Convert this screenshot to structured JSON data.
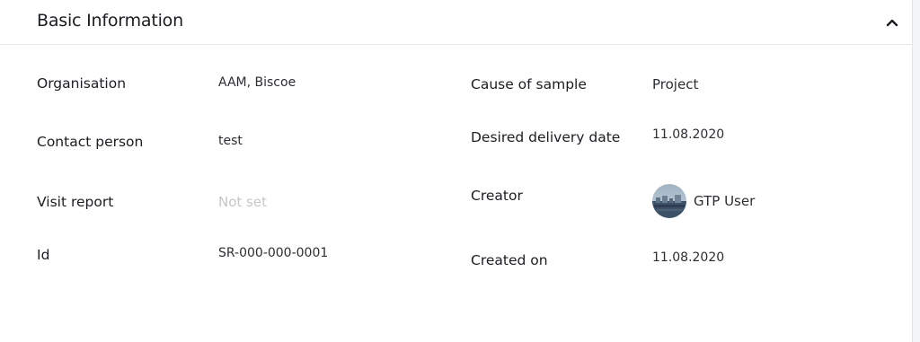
{
  "section": {
    "title": "Basic Information",
    "collapse_icon": "chevron-up-icon"
  },
  "left_fields": {
    "organisation": {
      "label": "Organisation",
      "value": "AAM, Biscoe"
    },
    "contact_person": {
      "label": "Contact person",
      "value": "test"
    },
    "visit_report": {
      "label": "Visit report",
      "value": "Not set"
    },
    "id": {
      "label": "Id",
      "value": "SR-000-000-0001"
    }
  },
  "right_fields": {
    "cause_of_sample": {
      "label": "Cause of sample",
      "value": "Project"
    },
    "desired_delivery_date": {
      "label": "Desired delivery date",
      "value": "11.08.2020"
    },
    "creator": {
      "label": "Creator",
      "value": "GTP User"
    },
    "created_on": {
      "label": "Created on",
      "value": "11.08.2020"
    }
  },
  "colors": {
    "muted_text": "#c4c7cb",
    "border": "#e6e8eb"
  }
}
